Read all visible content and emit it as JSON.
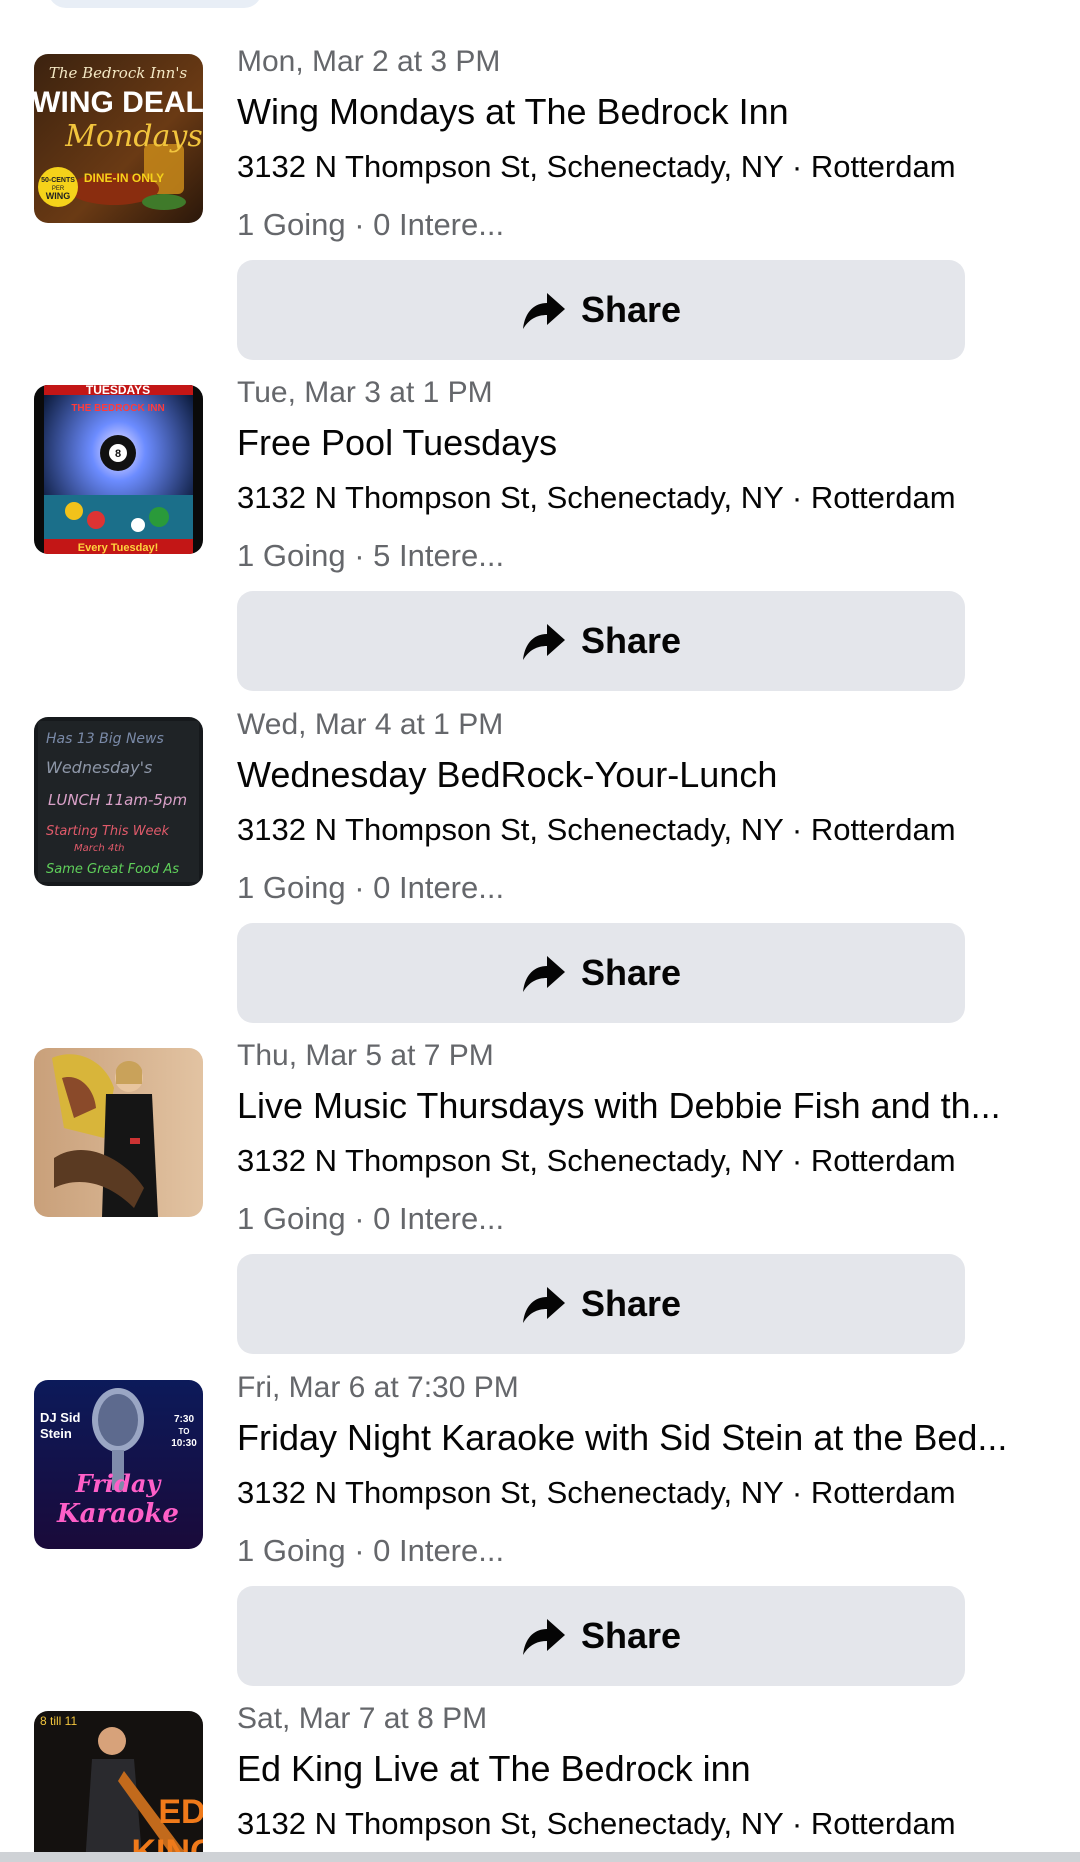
{
  "share_label": "Share",
  "events": [
    {
      "date": "Mon, Mar 2 at 3 PM",
      "title": "Wing Mondays at The Bedrock Inn",
      "address": "3132 N Thompson St, Schenectady, NY · Rotterdam",
      "stats": "1 Going · 0 Intere..."
    },
    {
      "date": "Tue, Mar 3 at 1 PM",
      "title": "Free Pool Tuesdays",
      "address": "3132 N Thompson St, Schenectady, NY · Rotterdam",
      "stats": "1 Going · 5 Intere..."
    },
    {
      "date": "Wed, Mar 4 at 1 PM",
      "title": "Wednesday BedRock-Your-Lunch",
      "address": "3132 N Thompson St, Schenectady, NY · Rotterdam",
      "stats": "1 Going · 0 Intere..."
    },
    {
      "date": "Thu, Mar 5 at 7 PM",
      "title": "Live Music Thursdays with Debbie Fish and th...",
      "address": "3132 N Thompson St, Schenectady, NY · Rotterdam",
      "stats": "1 Going · 0 Intere..."
    },
    {
      "date": "Fri, Mar 6 at 7:30 PM",
      "title": "Friday Night Karaoke with Sid Stein at the Bed...",
      "address": "3132 N Thompson St, Schenectady, NY · Rotterdam",
      "stats": "1 Going · 0 Intere..."
    },
    {
      "date": "Sat, Mar 7 at 8 PM",
      "title": "Ed King Live at The Bedrock inn",
      "address": "3132 N Thompson St, Schenectady, NY · Rotterdam"
    }
  ],
  "thumbnails": {
    "wing": {
      "line1": "The Bedrock Inn's",
      "line2": "WING DEAL",
      "line3": "Mondays",
      "badge_top": "50-CENTS",
      "badge_mid": "PER",
      "badge_bottom": "WING",
      "tag": "DINE-IN ONLY"
    },
    "pool": {
      "header": "TUESDAYS",
      "sub": "THE BEDROCK INN",
      "footer": "Every Tuesday!"
    },
    "lunch": {
      "line1": "Has 13 Big News",
      "line2": "Wednesday's",
      "line3": "LUNCH 11am-5pm",
      "line4": "Starting This Week",
      "line5": "March 4th",
      "line6": "Same Great Food As"
    },
    "karaoke": {
      "corner_left_1": "DJ Sid",
      "corner_left_2": "Stein",
      "corner_right_1": "7:30",
      "corner_right_2": "TO",
      "corner_right_3": "10:30",
      "word1": "Friday",
      "word2": "Karaoke"
    },
    "edking": {
      "corner": "8 till 11",
      "word1": "ED",
      "word2": "KING"
    }
  },
  "colors": {
    "text_primary": "#050505",
    "text_secondary": "#65676b",
    "button_bg": "#e4e6eb"
  }
}
